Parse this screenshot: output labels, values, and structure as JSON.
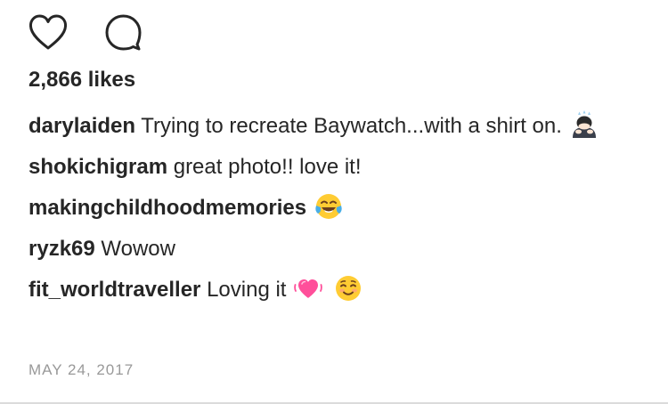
{
  "actions": {
    "like_icon": "heart-outline-icon",
    "comment_icon": "speech-bubble-icon"
  },
  "likes": "2,866 likes",
  "caption": {
    "username": "darylaiden",
    "text": "Trying to recreate Baywatch...with a shirt on.",
    "emoji": "person-bowing-emoji"
  },
  "comments": [
    {
      "username": "shokichigram",
      "text": "great photo!! love it!"
    },
    {
      "username": "makingchildhoodmemories",
      "text": "",
      "emoji": "tears-of-joy-emoji"
    },
    {
      "username": "ryzk69",
      "text": "Wowow"
    },
    {
      "username": "fit_worldtraveller",
      "text": "Loving it",
      "emojis": [
        "growing-heart-emoji",
        "smiling-face-emoji"
      ]
    }
  ],
  "timestamp": "MAY 24, 2017",
  "colors": {
    "text": "#262626",
    "timestamp": "#999999",
    "heart_pink": "#ff4f9a",
    "emoji_yellow": "#ffcc33"
  }
}
